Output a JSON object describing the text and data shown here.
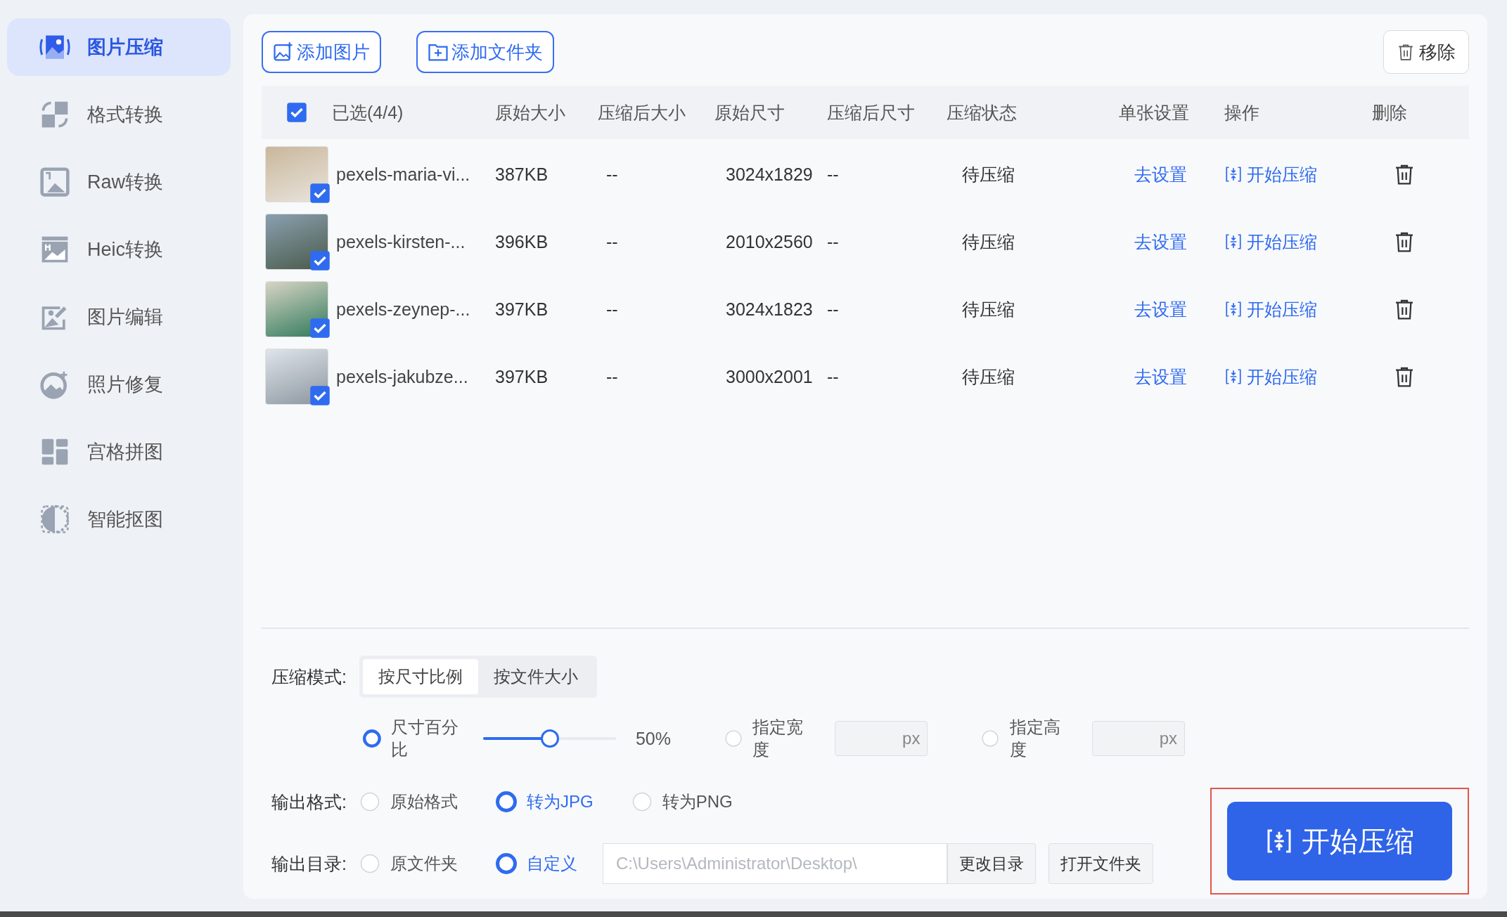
{
  "sidebar": {
    "items": [
      {
        "label": "图片压缩",
        "selected": true
      },
      {
        "label": "格式转换",
        "selected": false
      },
      {
        "label": "Raw转换",
        "selected": false
      },
      {
        "label": "Heic转换",
        "selected": false
      },
      {
        "label": "图片编辑",
        "selected": false
      },
      {
        "label": "照片修复",
        "selected": false
      },
      {
        "label": "宫格拼图",
        "selected": false
      },
      {
        "label": "智能抠图",
        "selected": false
      }
    ]
  },
  "toolbar": {
    "add_buttons": [
      {
        "kind": "image",
        "label": "添加图片"
      },
      {
        "kind": "folder",
        "label": "添加文件夹"
      }
    ],
    "remove_button": "移除"
  },
  "table": {
    "select_all": {
      "checked": true,
      "label": "已选(4/4)"
    },
    "columns": [
      "原始大小",
      "压缩后大小",
      "原始尺寸",
      "压缩后尺寸",
      "压缩状态",
      "单张设置",
      "操作",
      "删除"
    ],
    "rows": [
      {
        "checked": true,
        "name": "pexels-maria-vi...",
        "original_size": "387KB",
        "compressed_size": "--",
        "original_dimensions": "3024x1829",
        "compressed_dimensions": "--",
        "status": "待压缩",
        "setting": "去设置",
        "action": "开始压缩"
      },
      {
        "checked": true,
        "name": "pexels-kirsten-...",
        "original_size": "396KB",
        "compressed_size": "--",
        "original_dimensions": "2010x2560",
        "compressed_dimensions": "--",
        "status": "待压缩",
        "setting": "去设置",
        "action": "开始压缩"
      },
      {
        "checked": true,
        "name": "pexels-zeynep-...",
        "original_size": "397KB",
        "compressed_size": "--",
        "original_dimensions": "3024x1823",
        "compressed_dimensions": "--",
        "status": "待压缩",
        "setting": "去设置",
        "action": "开始压缩"
      },
      {
        "checked": true,
        "name": "pexels-jakubze...",
        "original_size": "397KB",
        "compressed_size": "--",
        "original_dimensions": "3000x2001",
        "compressed_dimensions": "--",
        "status": "待压缩",
        "setting": "去设置",
        "action": "开始压缩"
      }
    ]
  },
  "settings": {
    "mode": {
      "label": "压缩模式:",
      "options": [
        {
          "label": "按尺寸比例",
          "selected": true
        },
        {
          "label": "按文件大小",
          "selected": false
        }
      ]
    },
    "size_options": [
      {
        "kind": "slider",
        "label": "尺寸百分比",
        "selected": true,
        "level": 0.5,
        "reading": "50%"
      },
      {
        "kind": "field",
        "label": "指定宽度",
        "selected": false,
        "unit": "px"
      },
      {
        "kind": "field",
        "label": "指定高度",
        "selected": false,
        "unit": "px"
      }
    ],
    "output_format": {
      "label": "输出格式:",
      "options": [
        {
          "label": "原始格式",
          "selected": false
        },
        {
          "label": "转为JPG",
          "selected": true
        },
        {
          "label": "转为PNG",
          "selected": false
        }
      ]
    },
    "output_dir": {
      "label": "输出目录:",
      "options": [
        {
          "label": "原文件夹",
          "selected": false
        },
        {
          "label": "自定义",
          "selected": true
        }
      ],
      "path": "C:\\Users\\Administrator\\Desktop\\",
      "buttons": [
        "更改目录",
        "打开文件夹"
      ]
    },
    "start_button": {
      "label": "开始压缩",
      "highlighted": true
    }
  }
}
